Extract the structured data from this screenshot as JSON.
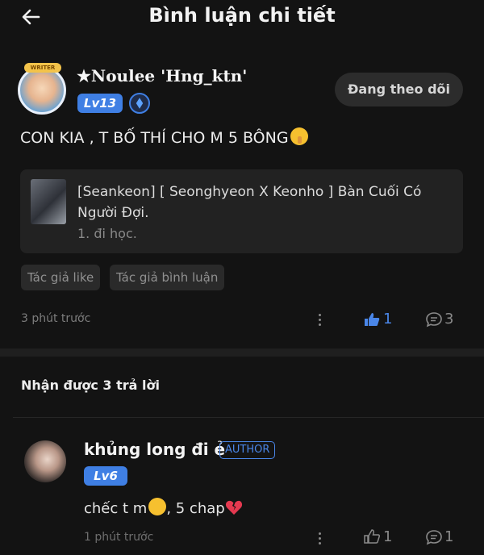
{
  "header": {
    "title": "Bình luận chi tiết"
  },
  "post": {
    "avatar_badge": "WRITER",
    "username": "★Noulee 'Hng_ktn'",
    "level": "Lv13",
    "follow_label": "Đang theo dõi",
    "comment_text": "CON KIA , T BỐ THÍ CHO M 5 BÔNG",
    "comment_emoji": "shushing-face-emoji",
    "quote": {
      "title": "[Seankeon] [ Seonghyeon X Keonho ] Bàn Cuối Có Người Đợi.",
      "subtitle": "1. đi học."
    },
    "tags": [
      "Tác giả like",
      "Tác giả bình luận"
    ],
    "time": "3 phút trước",
    "likes": "1",
    "comments": "3",
    "colors": {
      "accent": "#4a86e8",
      "like_active": "#4a86e8"
    }
  },
  "replies": {
    "heading": "Nhận được 3 trả lời",
    "items": [
      {
        "name": "khủng long đi ẻ",
        "author_badge": "AUTHOR",
        "level": "Lv6",
        "text_part1": "chếc t m",
        "text_part2": ", 5 chap",
        "time": "1 phút trước",
        "likes": "1",
        "comments": "1"
      }
    ]
  }
}
